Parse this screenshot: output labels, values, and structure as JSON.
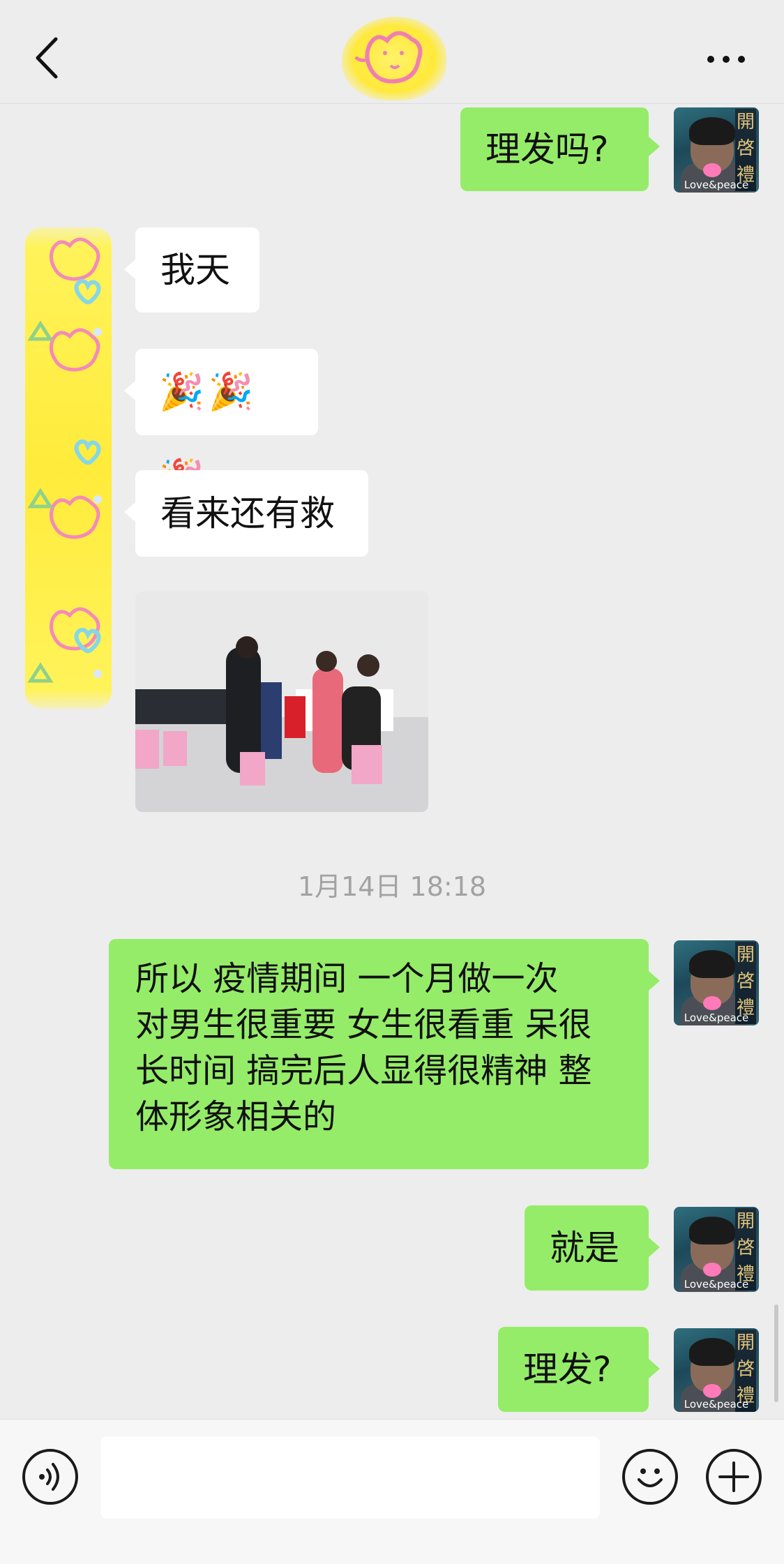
{
  "header": {
    "back_icon": "chevron-left-icon",
    "contact_avatar": "yellow-blurred-avatar",
    "more_icon": "more-dots-icon"
  },
  "messages": [
    {
      "from": "me",
      "text": "理发吗?"
    },
    {
      "from": "them",
      "text": "我天"
    },
    {
      "from": "them",
      "text": "🎉🎉🎉"
    },
    {
      "from": "them",
      "text": "看来还有救"
    },
    {
      "from": "them",
      "type": "image",
      "description_icon": "photo"
    },
    {
      "from": "me",
      "lines": [
        "所以 疫情期间  一个月做一次",
        "对男生很重要 女生很看重 呆很",
        "长时间 搞完后人显得很精神 整",
        "体形象相关的"
      ]
    },
    {
      "from": "me",
      "text": "就是"
    },
    {
      "from": "me",
      "text": "理发?"
    }
  ],
  "timestamp": "1月14日 18:18",
  "avatar_me": {
    "caption": "Love&peace",
    "calligraphy": [
      "開",
      "啓",
      "禮"
    ]
  },
  "input_bar": {
    "voice_icon": "voice-icon",
    "emoji_icon": "emoji-icon",
    "plus_icon": "plus-icon",
    "text_value": ""
  },
  "colors": {
    "background": "#ededed",
    "my_bubble": "#95ec69",
    "their_bubble": "#ffffff"
  }
}
